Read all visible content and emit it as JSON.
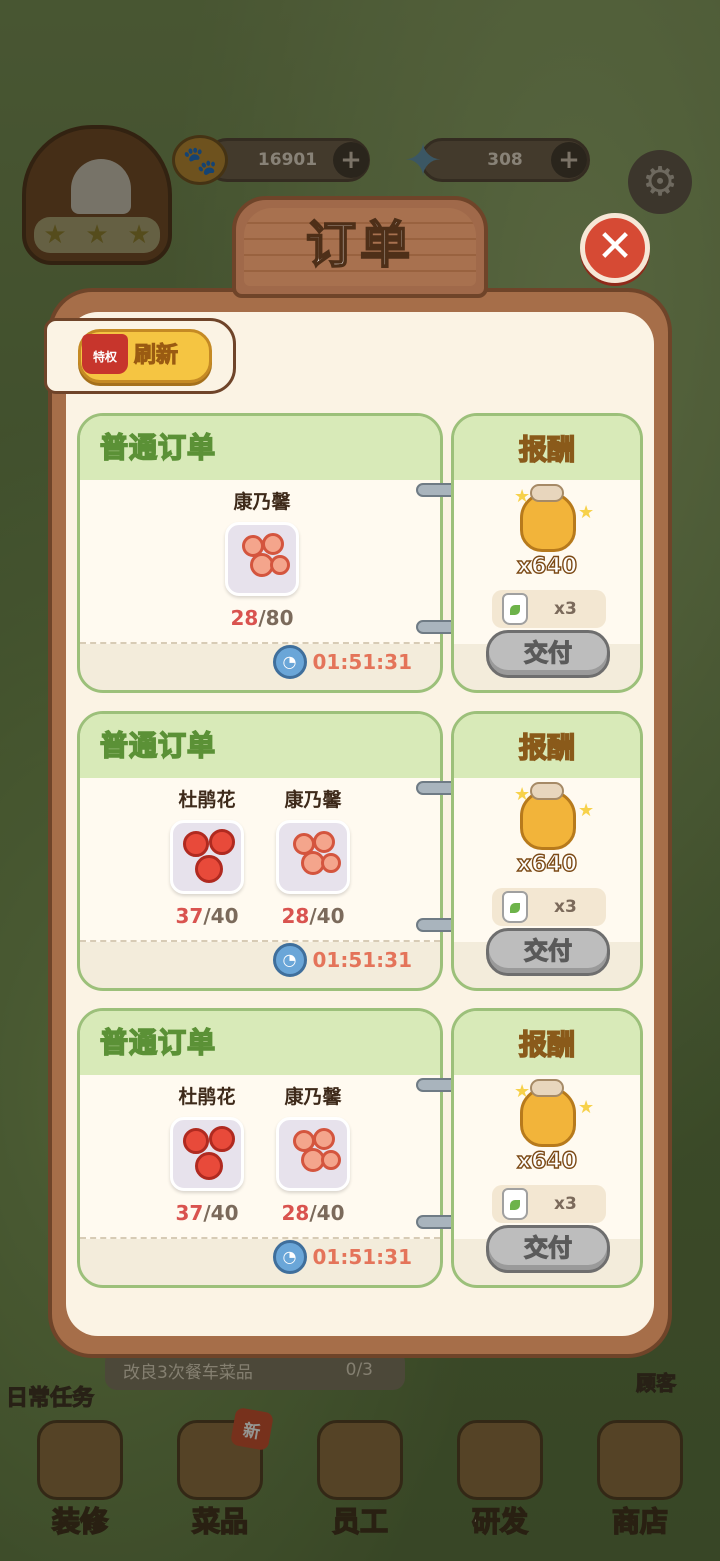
{
  "modal": {
    "title": "订单",
    "close_label": "✕"
  },
  "refresh": {
    "badge": "特权",
    "label": "刷新"
  },
  "resources": {
    "paw_coins": "16901",
    "gems": "308",
    "add_label": "+"
  },
  "background": {
    "task_text": "改良3次餐车菜品",
    "task_progress": "0/3",
    "daily_label": "日常任务",
    "visitor_label": "顾客",
    "nav": [
      {
        "label": "装修"
      },
      {
        "label": "菜品",
        "badge": "新"
      },
      {
        "label": "员工"
      },
      {
        "label": "研发"
      },
      {
        "label": "商店"
      }
    ]
  },
  "orders": [
    {
      "type_label": "普通订单",
      "items": [
        {
          "name": "康乃馨",
          "have": "28",
          "need": "/80",
          "icon": "carnation-icon"
        }
      ],
      "timer": "01:51:31",
      "reward_title": "报酬",
      "reward_qty": "x640",
      "extra_qty": "x3",
      "deliver_label": "交付"
    },
    {
      "type_label": "普通订单",
      "items": [
        {
          "name": "杜鹃花",
          "have": "37",
          "need": "/40",
          "icon": "azalea-icon"
        },
        {
          "name": "康乃馨",
          "have": "28",
          "need": "/40",
          "icon": "carnation-icon"
        }
      ],
      "timer": "01:51:31",
      "reward_title": "报酬",
      "reward_qty": "x640",
      "extra_qty": "x3",
      "deliver_label": "交付"
    },
    {
      "type_label": "普通订单",
      "items": [
        {
          "name": "杜鹃花",
          "have": "37",
          "need": "/40",
          "icon": "azalea-icon"
        },
        {
          "name": "康乃馨",
          "have": "28",
          "need": "/40",
          "icon": "carnation-icon"
        }
      ],
      "timer": "01:51:31",
      "reward_title": "报酬",
      "reward_qty": "x640",
      "extra_qty": "x3",
      "deliver_label": "交付"
    }
  ],
  "colors": {
    "panel": "#a66e49",
    "card_border": "#9cc07a",
    "deliver_disabled": "#bdbdbd",
    "have_count": "#d9534f",
    "timer": "#e4745a"
  }
}
